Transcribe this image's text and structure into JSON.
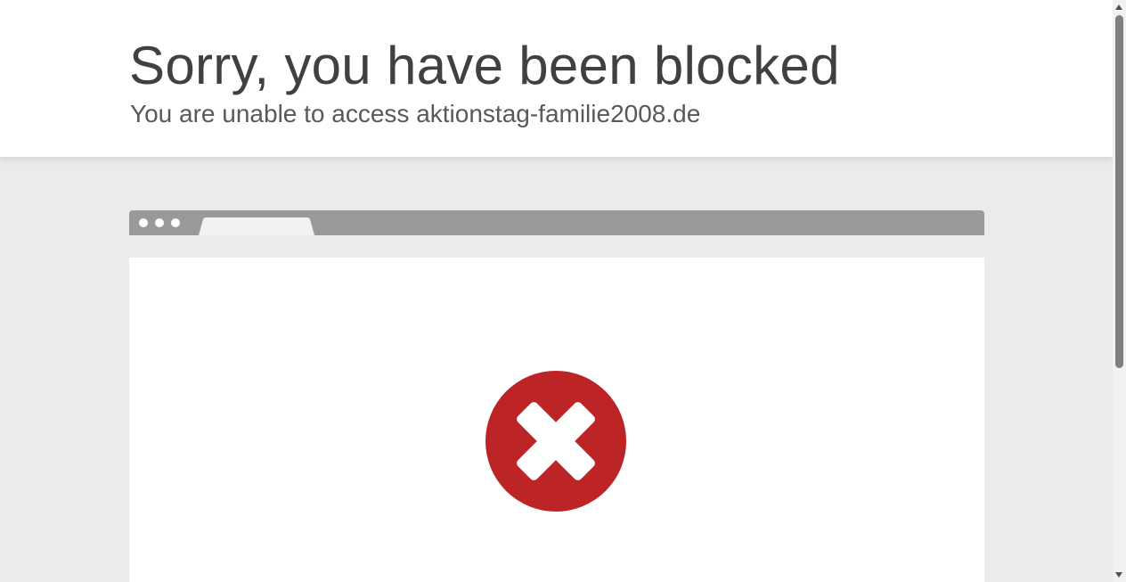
{
  "header": {
    "title": "Sorry, you have been blocked",
    "subtitle": "You are unable to access aktionstag-familie2008.de"
  },
  "browser_illustration": {
    "icon": "block-x-icon",
    "colors": {
      "bar": "#999999",
      "tab": "#f2f2f2",
      "error_circle": "#bd2426",
      "cross": "#ffffff"
    }
  },
  "scrollbar": {
    "up_icon": "scroll-up-arrow-icon",
    "down_icon": "scroll-down-arrow-icon"
  }
}
